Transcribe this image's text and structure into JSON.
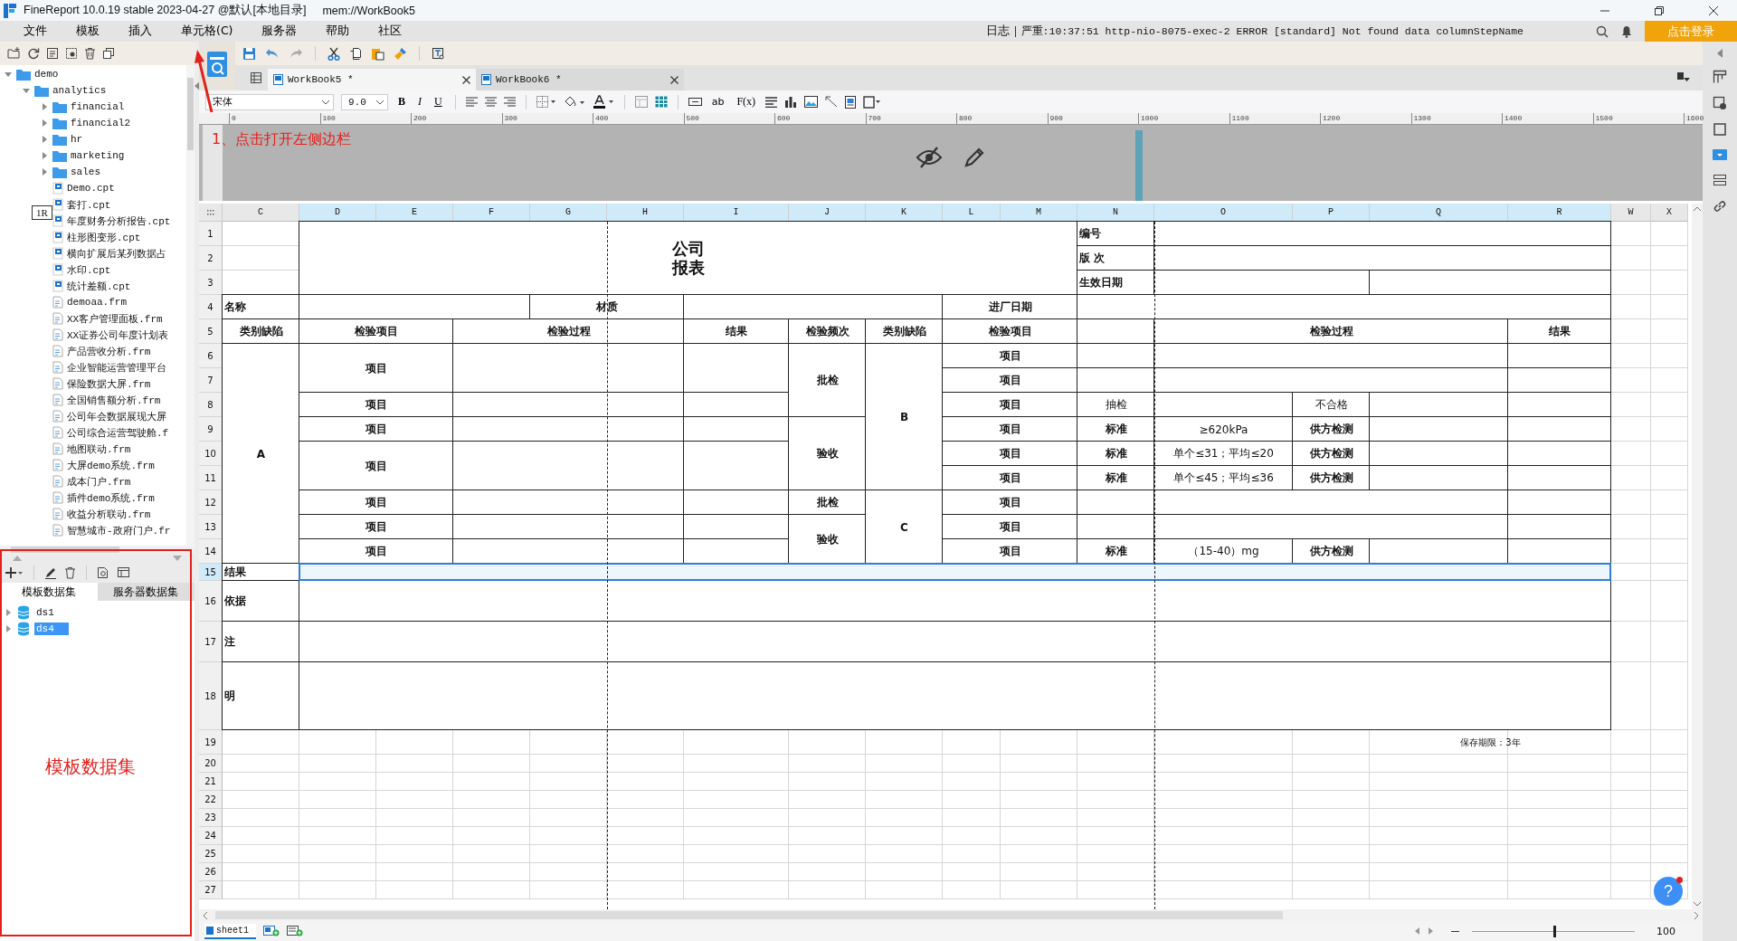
{
  "title_bar": {
    "app": "FineReport 10.0.19 stable 2023-04-27 @默认[本地目录]",
    "path": "mem://WorkBook5"
  },
  "menu": [
    "文件",
    "模板",
    "插入",
    "单元格(C)",
    "服务器",
    "帮助",
    "社区"
  ],
  "log": {
    "label": "日志",
    "message": "严重:10:37:51 http-nio-8075-exec-2 ERROR [standard] Not found data columnStepName"
  },
  "login_button": "点击登录",
  "file_tree": [
    {
      "label": "demo",
      "kind": "folder",
      "expanded": true,
      "children": [
        {
          "label": "analytics",
          "kind": "folder",
          "expanded": true,
          "children": [
            {
              "label": "financial",
              "kind": "folder",
              "expanded": false
            },
            {
              "label": "financial2",
              "kind": "folder",
              "expanded": false
            },
            {
              "label": "hr",
              "kind": "folder",
              "expanded": false
            },
            {
              "label": "marketing",
              "kind": "folder",
              "expanded": false
            },
            {
              "label": "sales",
              "kind": "folder",
              "expanded": false
            },
            {
              "label": "Demo.cpt",
              "kind": "report"
            },
            {
              "label": "套打.cpt",
              "kind": "report"
            },
            {
              "label": "年度财务分析报告.cpt",
              "kind": "report"
            },
            {
              "label": "柱形图变形.cpt",
              "kind": "report"
            },
            {
              "label": "横向扩展后某列数据占",
              "kind": "report"
            },
            {
              "label": "水印.cpt",
              "kind": "report"
            },
            {
              "label": "统计差额.cpt",
              "kind": "report"
            },
            {
              "label": "demoaa.frm",
              "kind": "form"
            },
            {
              "label": "XX客户管理面板.frm",
              "kind": "form"
            },
            {
              "label": "XX证券公司年度计划表",
              "kind": "form"
            },
            {
              "label": "产品营收分析.frm",
              "kind": "form"
            },
            {
              "label": "企业智能运营管理平台",
              "kind": "form"
            },
            {
              "label": "保险数据大屏.frm",
              "kind": "form"
            },
            {
              "label": "全国销售额分析.frm",
              "kind": "form"
            },
            {
              "label": "公司年会数据展现大屏",
              "kind": "form"
            },
            {
              "label": "公司综合运营驾驶舱.f",
              "kind": "form"
            },
            {
              "label": "地图联动.frm",
              "kind": "form"
            },
            {
              "label": "大屏demo系统.frm",
              "kind": "form"
            },
            {
              "label": "成本门户.frm",
              "kind": "form"
            },
            {
              "label": "插件demo系统.frm",
              "kind": "form"
            },
            {
              "label": "收益分析联动.frm",
              "kind": "form"
            },
            {
              "label": "智慧城市-政府门户.fr",
              "kind": "form"
            }
          ]
        }
      ]
    }
  ],
  "tree_tooltip": "1R",
  "dataset_tabs": [
    {
      "label": "模板数据集",
      "selected": true
    },
    {
      "label": "服务器数据集",
      "selected": false
    }
  ],
  "datasets": [
    {
      "label": "ds1",
      "selected": false
    },
    {
      "label": "ds4",
      "selected": true
    }
  ],
  "workbook_tabs": [
    {
      "label": "WorkBook5 *",
      "selected": true
    },
    {
      "label": "WorkBook6 *",
      "selected": false
    }
  ],
  "format_toolbar": {
    "font": "宋体",
    "size": "9.0",
    "style_buttons": [
      "B",
      "I",
      "U"
    ],
    "text_tools": [
      "ab",
      "F(x)"
    ]
  },
  "ruler_marks": [
    "0",
    "100",
    "200",
    "300",
    "400",
    "500",
    "600",
    "700",
    "800",
    "900",
    "1000",
    "1100",
    "1200",
    "1300",
    "1400",
    "1500",
    "1600"
  ],
  "annotations": {
    "step_note": "1、点击打开左侧边栏",
    "panel_note": "模板数据集"
  },
  "sheet": {
    "columns": [
      {
        "label": "C",
        "selected": false
      },
      {
        "label": "D",
        "selected": true
      },
      {
        "label": "E",
        "selected": true
      },
      {
        "label": "F",
        "selected": true
      },
      {
        "label": "G",
        "selected": true
      },
      {
        "label": "H",
        "selected": true
      },
      {
        "label": "I",
        "selected": true
      },
      {
        "label": "J",
        "selected": true
      },
      {
        "label": "K",
        "selected": true
      },
      {
        "label": "L",
        "selected": true
      },
      {
        "label": "M",
        "selected": true
      },
      {
        "label": "N",
        "selected": true
      },
      {
        "label": "O",
        "selected": true
      },
      {
        "label": "P",
        "selected": true
      },
      {
        "label": "Q",
        "selected": true
      },
      {
        "label": "R",
        "selected": true
      },
      {
        "label": "W",
        "selected": false
      },
      {
        "label": "X",
        "selected": false
      }
    ],
    "rows": [
      {
        "label": "1",
        "selected": false
      },
      {
        "label": "2",
        "selected": false
      },
      {
        "label": "3",
        "selected": false
      },
      {
        "label": "4",
        "selected": false
      },
      {
        "label": "5",
        "selected": false
      },
      {
        "label": "6",
        "selected": false
      },
      {
        "label": "7",
        "selected": false
      },
      {
        "label": "8",
        "selected": false
      },
      {
        "label": "9",
        "selected": false
      },
      {
        "label": "10",
        "selected": false
      },
      {
        "label": "11",
        "selected": false
      },
      {
        "label": "12",
        "selected": false
      },
      {
        "label": "13",
        "selected": false
      },
      {
        "label": "14",
        "selected": false
      },
      {
        "label": "15",
        "selected": true
      },
      {
        "label": "16",
        "selected": false
      },
      {
        "label": "17",
        "selected": false
      },
      {
        "label": "18",
        "selected": false
      },
      {
        "label": "19",
        "selected": false
      },
      {
        "label": "20",
        "selected": false
      },
      {
        "label": "21",
        "selected": false
      },
      {
        "label": "22",
        "selected": false
      },
      {
        "label": "23",
        "selected": false
      },
      {
        "label": "24",
        "selected": false
      },
      {
        "label": "25",
        "selected": false
      },
      {
        "label": "26",
        "selected": false
      },
      {
        "label": "27",
        "selected": false
      }
    ],
    "cells": [
      {
        "text": "公司报表",
        "kind": "title"
      },
      {
        "text": "编号",
        "kind": "header"
      },
      {
        "text": "版 次",
        "kind": "header"
      },
      {
        "text": "生效日期",
        "kind": "header"
      },
      {
        "text": "名称",
        "kind": "header"
      },
      {
        "text": "材质",
        "kind": "header"
      },
      {
        "text": "进厂日期",
        "kind": "header"
      },
      {
        "text": "类别缺陷",
        "kind": "header"
      },
      {
        "text": "检验项目",
        "kind": "header"
      },
      {
        "text": "检验过程",
        "kind": "header"
      },
      {
        "text": "结果",
        "kind": "header"
      },
      {
        "text": "检验频次",
        "kind": "header"
      },
      {
        "text": "类别缺陷",
        "kind": "header"
      },
      {
        "text": "检验项目",
        "kind": "header"
      },
      {
        "text": "检验过程",
        "kind": "header"
      },
      {
        "text": "结果",
        "kind": "header"
      },
      {
        "text": "A",
        "kind": "header"
      },
      {
        "text": "项目",
        "kind": "header"
      },
      {
        "text": "批检",
        "kind": "header"
      },
      {
        "text": "B",
        "kind": "header"
      },
      {
        "text": "项目",
        "kind": "header"
      },
      {
        "text": "项目",
        "kind": "header"
      },
      {
        "text": "项目",
        "kind": "header"
      },
      {
        "text": "项目",
        "kind": "header"
      },
      {
        "text": "抽检",
        "kind": "value"
      },
      {
        "text": "不合格",
        "kind": "value"
      },
      {
        "text": "项目",
        "kind": "header"
      },
      {
        "text": "验收",
        "kind": "header"
      },
      {
        "text": "项目",
        "kind": "header"
      },
      {
        "text": "标准",
        "kind": "header"
      },
      {
        "text": "≥620kPa",
        "kind": "value"
      },
      {
        "text": "供方检测",
        "kind": "header"
      },
      {
        "text": "项目",
        "kind": "header"
      },
      {
        "text": "项目",
        "kind": "header"
      },
      {
        "text": "标准",
        "kind": "header"
      },
      {
        "text": "单个≤31；平均≤20",
        "kind": "value"
      },
      {
        "text": "供方检测",
        "kind": "header"
      },
      {
        "text": "项目",
        "kind": "header"
      },
      {
        "text": "标准",
        "kind": "header"
      },
      {
        "text": "单个≤45；平均≤36",
        "kind": "value"
      },
      {
        "text": "供方检测",
        "kind": "header"
      },
      {
        "text": "项目",
        "kind": "header"
      },
      {
        "text": "批检",
        "kind": "header"
      },
      {
        "text": "C",
        "kind": "header"
      },
      {
        "text": "项目",
        "kind": "header"
      },
      {
        "text": "项目",
        "kind": "header"
      },
      {
        "text": "验收",
        "kind": "header"
      },
      {
        "text": "项目",
        "kind": "header"
      },
      {
        "text": "项目",
        "kind": "header"
      },
      {
        "text": "项目",
        "kind": "header"
      },
      {
        "text": "标准",
        "kind": "header"
      },
      {
        "text": "（15-40）mg",
        "kind": "value"
      },
      {
        "text": "供方检测",
        "kind": "header"
      },
      {
        "text": "结果",
        "kind": "header"
      },
      {
        "text": "依据",
        "kind": "header"
      },
      {
        "text": "注",
        "kind": "header"
      },
      {
        "text": "明",
        "kind": "header"
      },
      {
        "text": "保存期限：3年",
        "kind": "note"
      }
    ]
  },
  "help_button": "?",
  "sheet_tabs": [
    {
      "label": "sheet1",
      "selected": true
    }
  ],
  "zoom": {
    "level": 0.5,
    "reading": "100"
  }
}
